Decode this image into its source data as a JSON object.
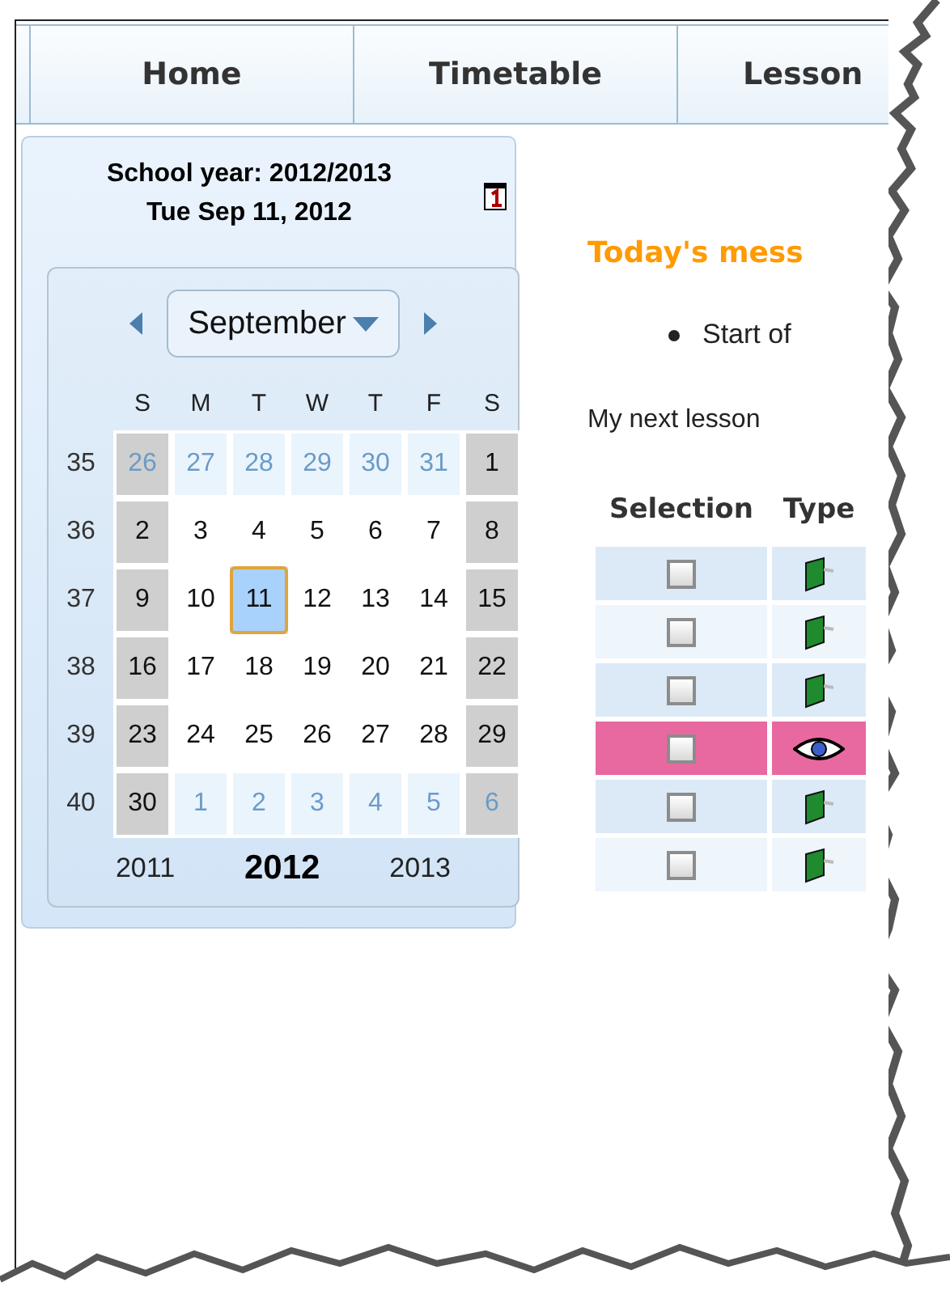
{
  "tabs": [
    {
      "label": "Home",
      "selected": false
    },
    {
      "label": "Timetable",
      "selected": false
    },
    {
      "label": "Lesson",
      "selected": false
    }
  ],
  "calendar": {
    "school_year": "School year: 2012/2013",
    "current_date": "Tue Sep 11, 2012",
    "month": "September",
    "weekdays": [
      "S",
      "M",
      "T",
      "W",
      "T",
      "F",
      "S"
    ],
    "weeks": [
      {
        "number": "35",
        "days": [
          {
            "day": "26",
            "outside": true,
            "weekend": true,
            "selected": false
          },
          {
            "day": "27",
            "outside": true,
            "weekend": false,
            "selected": false
          },
          {
            "day": "28",
            "outside": true,
            "weekend": false,
            "selected": false
          },
          {
            "day": "29",
            "outside": true,
            "weekend": false,
            "selected": false
          },
          {
            "day": "30",
            "outside": true,
            "weekend": false,
            "selected": false
          },
          {
            "day": "31",
            "outside": true,
            "weekend": false,
            "selected": false
          },
          {
            "day": "1",
            "outside": false,
            "weekend": true,
            "selected": false
          }
        ]
      },
      {
        "number": "36",
        "days": [
          {
            "day": "2",
            "outside": false,
            "weekend": true,
            "selected": false
          },
          {
            "day": "3",
            "outside": false,
            "weekend": false,
            "selected": false
          },
          {
            "day": "4",
            "outside": false,
            "weekend": false,
            "selected": false
          },
          {
            "day": "5",
            "outside": false,
            "weekend": false,
            "selected": false
          },
          {
            "day": "6",
            "outside": false,
            "weekend": false,
            "selected": false
          },
          {
            "day": "7",
            "outside": false,
            "weekend": false,
            "selected": false
          },
          {
            "day": "8",
            "outside": false,
            "weekend": true,
            "selected": false
          }
        ]
      },
      {
        "number": "37",
        "days": [
          {
            "day": "9",
            "outside": false,
            "weekend": true,
            "selected": false
          },
          {
            "day": "10",
            "outside": false,
            "weekend": false,
            "selected": false
          },
          {
            "day": "11",
            "outside": false,
            "weekend": false,
            "selected": true
          },
          {
            "day": "12",
            "outside": false,
            "weekend": false,
            "selected": false
          },
          {
            "day": "13",
            "outside": false,
            "weekend": false,
            "selected": false
          },
          {
            "day": "14",
            "outside": false,
            "weekend": false,
            "selected": false
          },
          {
            "day": "15",
            "outside": false,
            "weekend": true,
            "selected": false
          }
        ]
      },
      {
        "number": "38",
        "days": [
          {
            "day": "16",
            "outside": false,
            "weekend": true,
            "selected": false
          },
          {
            "day": "17",
            "outside": false,
            "weekend": false,
            "selected": false
          },
          {
            "day": "18",
            "outside": false,
            "weekend": false,
            "selected": false
          },
          {
            "day": "19",
            "outside": false,
            "weekend": false,
            "selected": false
          },
          {
            "day": "20",
            "outside": false,
            "weekend": false,
            "selected": false
          },
          {
            "day": "21",
            "outside": false,
            "weekend": false,
            "selected": false
          },
          {
            "day": "22",
            "outside": false,
            "weekend": true,
            "selected": false
          }
        ]
      },
      {
        "number": "39",
        "days": [
          {
            "day": "23",
            "outside": false,
            "weekend": true,
            "selected": false
          },
          {
            "day": "24",
            "outside": false,
            "weekend": false,
            "selected": false
          },
          {
            "day": "25",
            "outside": false,
            "weekend": false,
            "selected": false
          },
          {
            "day": "26",
            "outside": false,
            "weekend": false,
            "selected": false
          },
          {
            "day": "27",
            "outside": false,
            "weekend": false,
            "selected": false
          },
          {
            "day": "28",
            "outside": false,
            "weekend": false,
            "selected": false
          },
          {
            "day": "29",
            "outside": false,
            "weekend": true,
            "selected": false
          }
        ]
      },
      {
        "number": "40",
        "days": [
          {
            "day": "30",
            "outside": false,
            "weekend": true,
            "selected": false
          },
          {
            "day": "1",
            "outside": true,
            "weekend": false,
            "selected": false
          },
          {
            "day": "2",
            "outside": true,
            "weekend": false,
            "selected": false
          },
          {
            "day": "3",
            "outside": true,
            "weekend": false,
            "selected": false
          },
          {
            "day": "4",
            "outside": true,
            "weekend": false,
            "selected": false
          },
          {
            "day": "5",
            "outside": true,
            "weekend": false,
            "selected": false
          },
          {
            "day": "6",
            "outside": true,
            "weekend": true,
            "selected": false
          }
        ]
      }
    ],
    "years": [
      {
        "label": "2011",
        "selected": false
      },
      {
        "label": "2012",
        "selected": true
      },
      {
        "label": "2013",
        "selected": false
      }
    ]
  },
  "messages": {
    "title": "Today's mess",
    "items": [
      "Start of"
    ]
  },
  "next_lesson": {
    "label": "My next lesson",
    "columns": [
      "Selection",
      "Type"
    ],
    "rows": [
      {
        "checked": false,
        "kind": "lesson",
        "highlighted": false
      },
      {
        "checked": false,
        "kind": "lesson",
        "highlighted": false
      },
      {
        "checked": false,
        "kind": "lesson",
        "highlighted": false
      },
      {
        "checked": false,
        "kind": "event",
        "highlighted": true
      },
      {
        "checked": false,
        "kind": "lesson",
        "highlighted": false
      },
      {
        "checked": false,
        "kind": "lesson",
        "highlighted": false
      }
    ]
  }
}
